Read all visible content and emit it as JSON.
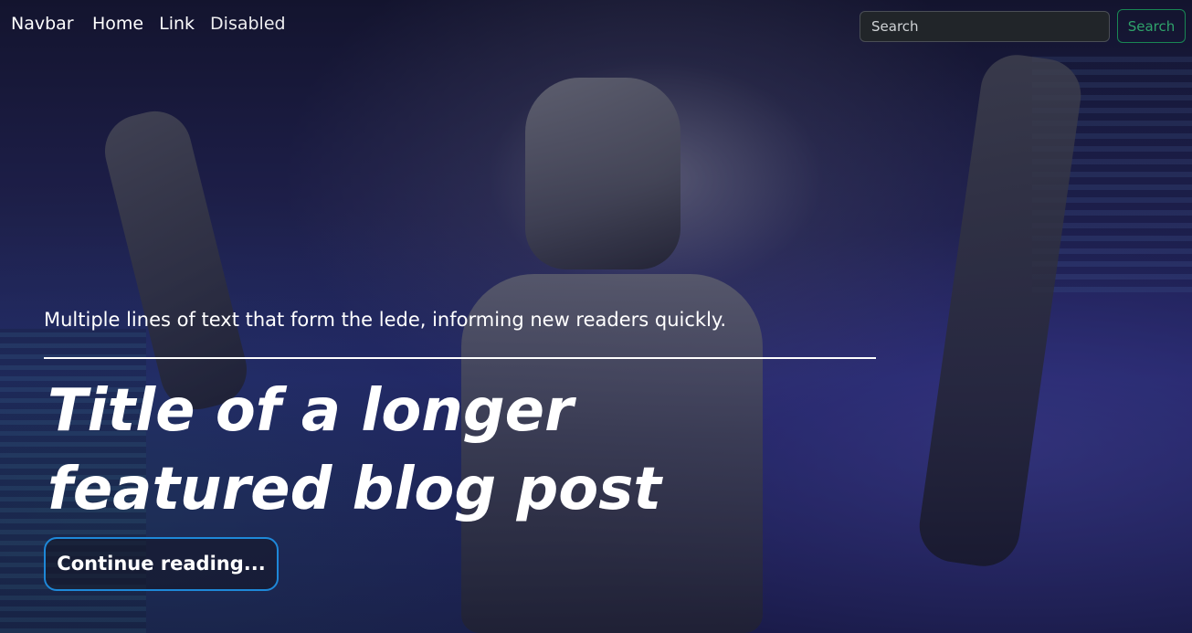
{
  "navbar": {
    "brand": "Navbar",
    "links": [
      {
        "label": "Home"
      },
      {
        "label": "Link"
      },
      {
        "label": "Disabled"
      }
    ],
    "search": {
      "placeholder": "Search",
      "button_label": "Search"
    }
  },
  "hero": {
    "lede": "Multiple lines of text that form the lede, informing new readers quickly.",
    "title": "Title of a longer featured blog post",
    "cta_label": "Continue reading..."
  },
  "colors": {
    "search_button_border": "#198754",
    "cta_border": "#1e88d8",
    "text": "#ffffff"
  }
}
